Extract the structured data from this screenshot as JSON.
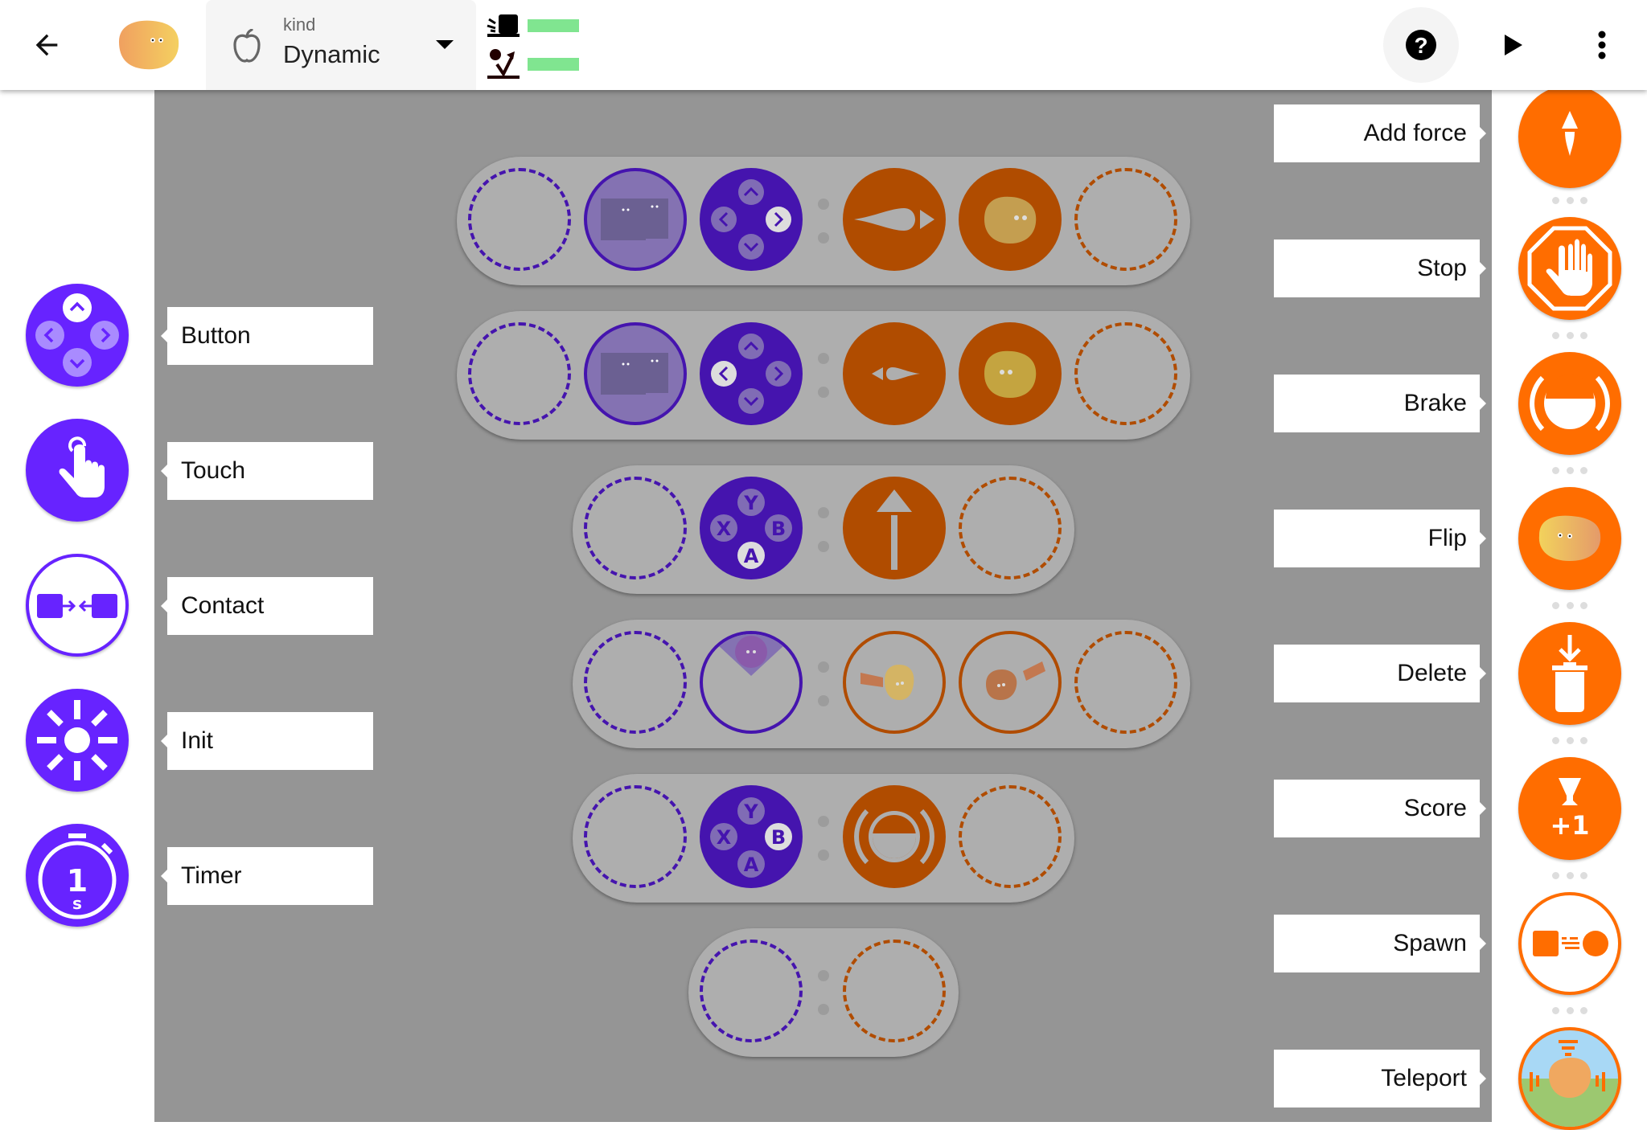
{
  "header": {
    "back_icon": "arrow-left-icon",
    "avatar": "potato-character",
    "kind": {
      "label": "kind",
      "value": "Dynamic",
      "icon": "apple-outline-icon"
    },
    "stats": [
      {
        "icon": "collision-icon",
        "bar_color": "#80e590"
      },
      {
        "icon": "bounce-icon",
        "bar_color": "#80e590"
      }
    ],
    "help_icon": "help-circle-icon",
    "play_icon": "play-icon",
    "more_icon": "more-vert-icon"
  },
  "colors": {
    "when_accent": "#6723ff",
    "do_accent": "#ff6d00",
    "when_dim": "#4514ae",
    "do_dim": "#b04c00",
    "canvas_bg": "#959595",
    "rule_bg": "#aeaeae",
    "stat_bar": "#80e590"
  },
  "when_palette": [
    {
      "label": "Button",
      "icon": "dpad-icon"
    },
    {
      "label": "Touch",
      "icon": "touch-hand-icon"
    },
    {
      "label": "Contact",
      "icon": "contact-arrows-icon"
    },
    {
      "label": "Init",
      "icon": "init-sun-icon"
    },
    {
      "label": "Timer",
      "icon": "timer-icon",
      "timer_value": "1",
      "timer_unit": "s"
    }
  ],
  "do_palette": [
    {
      "label": "Add force",
      "icon": "add-force-icon"
    },
    {
      "label": "Stop",
      "icon": "stop-hand-icon"
    },
    {
      "label": "Brake",
      "icon": "brake-icon"
    },
    {
      "label": "Flip",
      "icon": "flip-potato-icon"
    },
    {
      "label": "Delete",
      "icon": "delete-icon"
    },
    {
      "label": "Score",
      "icon": "score-trophy-icon",
      "score_text": "+1"
    },
    {
      "label": "Spawn",
      "icon": "spawn-icon"
    },
    {
      "label": "Teleport",
      "icon": "teleport-icon"
    }
  ],
  "rules": [
    {
      "when": [
        "empty",
        "touch-sprite",
        "dpad-right"
      ],
      "do": [
        "force-right",
        "potato",
        "empty"
      ]
    },
    {
      "when": [
        "empty",
        "touch-sprite",
        "dpad-left"
      ],
      "do": [
        "force-left",
        "potato",
        "empty"
      ]
    },
    {
      "when": [
        "empty",
        "abxy-a"
      ],
      "do": [
        "force-up",
        "empty"
      ]
    },
    {
      "when": [
        "empty",
        "contact-top"
      ],
      "do": [
        "push-potato-right",
        "push-potato-left",
        "empty"
      ]
    },
    {
      "when": [
        "empty",
        "abxy-b"
      ],
      "do": [
        "brake",
        "empty"
      ]
    },
    {
      "when": [
        "empty"
      ],
      "do": [
        "empty"
      ]
    }
  ],
  "abxy": {
    "y": "Y",
    "x": "X",
    "b": "B",
    "a": "A"
  }
}
